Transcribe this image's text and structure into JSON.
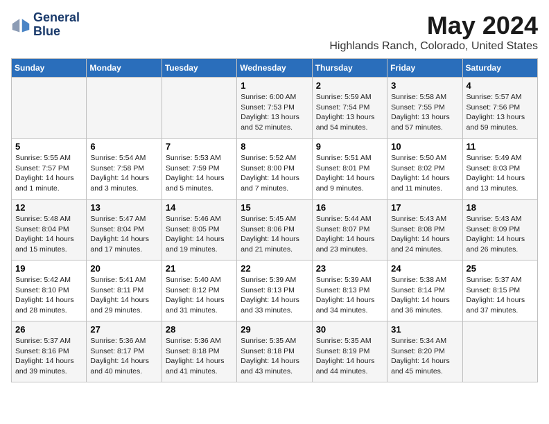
{
  "logo": {
    "line1": "General",
    "line2": "Blue"
  },
  "title": "May 2024",
  "location": "Highlands Ranch, Colorado, United States",
  "headers": [
    "Sunday",
    "Monday",
    "Tuesday",
    "Wednesday",
    "Thursday",
    "Friday",
    "Saturday"
  ],
  "weeks": [
    [
      {
        "day": "",
        "info": ""
      },
      {
        "day": "",
        "info": ""
      },
      {
        "day": "",
        "info": ""
      },
      {
        "day": "1",
        "info": "Sunrise: 6:00 AM\nSunset: 7:53 PM\nDaylight: 13 hours\nand 52 minutes."
      },
      {
        "day": "2",
        "info": "Sunrise: 5:59 AM\nSunset: 7:54 PM\nDaylight: 13 hours\nand 54 minutes."
      },
      {
        "day": "3",
        "info": "Sunrise: 5:58 AM\nSunset: 7:55 PM\nDaylight: 13 hours\nand 57 minutes."
      },
      {
        "day": "4",
        "info": "Sunrise: 5:57 AM\nSunset: 7:56 PM\nDaylight: 13 hours\nand 59 minutes."
      }
    ],
    [
      {
        "day": "5",
        "info": "Sunrise: 5:55 AM\nSunset: 7:57 PM\nDaylight: 14 hours\nand 1 minute."
      },
      {
        "day": "6",
        "info": "Sunrise: 5:54 AM\nSunset: 7:58 PM\nDaylight: 14 hours\nand 3 minutes."
      },
      {
        "day": "7",
        "info": "Sunrise: 5:53 AM\nSunset: 7:59 PM\nDaylight: 14 hours\nand 5 minutes."
      },
      {
        "day": "8",
        "info": "Sunrise: 5:52 AM\nSunset: 8:00 PM\nDaylight: 14 hours\nand 7 minutes."
      },
      {
        "day": "9",
        "info": "Sunrise: 5:51 AM\nSunset: 8:01 PM\nDaylight: 14 hours\nand 9 minutes."
      },
      {
        "day": "10",
        "info": "Sunrise: 5:50 AM\nSunset: 8:02 PM\nDaylight: 14 hours\nand 11 minutes."
      },
      {
        "day": "11",
        "info": "Sunrise: 5:49 AM\nSunset: 8:03 PM\nDaylight: 14 hours\nand 13 minutes."
      }
    ],
    [
      {
        "day": "12",
        "info": "Sunrise: 5:48 AM\nSunset: 8:04 PM\nDaylight: 14 hours\nand 15 minutes."
      },
      {
        "day": "13",
        "info": "Sunrise: 5:47 AM\nSunset: 8:04 PM\nDaylight: 14 hours\nand 17 minutes."
      },
      {
        "day": "14",
        "info": "Sunrise: 5:46 AM\nSunset: 8:05 PM\nDaylight: 14 hours\nand 19 minutes."
      },
      {
        "day": "15",
        "info": "Sunrise: 5:45 AM\nSunset: 8:06 PM\nDaylight: 14 hours\nand 21 minutes."
      },
      {
        "day": "16",
        "info": "Sunrise: 5:44 AM\nSunset: 8:07 PM\nDaylight: 14 hours\nand 23 minutes."
      },
      {
        "day": "17",
        "info": "Sunrise: 5:43 AM\nSunset: 8:08 PM\nDaylight: 14 hours\nand 24 minutes."
      },
      {
        "day": "18",
        "info": "Sunrise: 5:43 AM\nSunset: 8:09 PM\nDaylight: 14 hours\nand 26 minutes."
      }
    ],
    [
      {
        "day": "19",
        "info": "Sunrise: 5:42 AM\nSunset: 8:10 PM\nDaylight: 14 hours\nand 28 minutes."
      },
      {
        "day": "20",
        "info": "Sunrise: 5:41 AM\nSunset: 8:11 PM\nDaylight: 14 hours\nand 29 minutes."
      },
      {
        "day": "21",
        "info": "Sunrise: 5:40 AM\nSunset: 8:12 PM\nDaylight: 14 hours\nand 31 minutes."
      },
      {
        "day": "22",
        "info": "Sunrise: 5:39 AM\nSunset: 8:13 PM\nDaylight: 14 hours\nand 33 minutes."
      },
      {
        "day": "23",
        "info": "Sunrise: 5:39 AM\nSunset: 8:13 PM\nDaylight: 14 hours\nand 34 minutes."
      },
      {
        "day": "24",
        "info": "Sunrise: 5:38 AM\nSunset: 8:14 PM\nDaylight: 14 hours\nand 36 minutes."
      },
      {
        "day": "25",
        "info": "Sunrise: 5:37 AM\nSunset: 8:15 PM\nDaylight: 14 hours\nand 37 minutes."
      }
    ],
    [
      {
        "day": "26",
        "info": "Sunrise: 5:37 AM\nSunset: 8:16 PM\nDaylight: 14 hours\nand 39 minutes."
      },
      {
        "day": "27",
        "info": "Sunrise: 5:36 AM\nSunset: 8:17 PM\nDaylight: 14 hours\nand 40 minutes."
      },
      {
        "day": "28",
        "info": "Sunrise: 5:36 AM\nSunset: 8:18 PM\nDaylight: 14 hours\nand 41 minutes."
      },
      {
        "day": "29",
        "info": "Sunrise: 5:35 AM\nSunset: 8:18 PM\nDaylight: 14 hours\nand 43 minutes."
      },
      {
        "day": "30",
        "info": "Sunrise: 5:35 AM\nSunset: 8:19 PM\nDaylight: 14 hours\nand 44 minutes."
      },
      {
        "day": "31",
        "info": "Sunrise: 5:34 AM\nSunset: 8:20 PM\nDaylight: 14 hours\nand 45 minutes."
      },
      {
        "day": "",
        "info": ""
      }
    ]
  ]
}
